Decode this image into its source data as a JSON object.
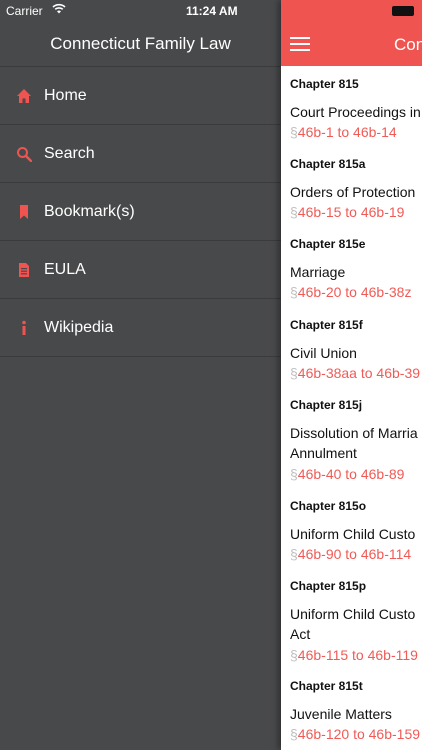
{
  "status": {
    "carrier": "Carrier",
    "time": "11:24 AM"
  },
  "drawer": {
    "title": "Connecticut Family Law",
    "items": [
      {
        "label": "Home",
        "icon": "home-icon"
      },
      {
        "label": "Search",
        "icon": "search-icon"
      },
      {
        "label": "Bookmark(s)",
        "icon": "bookmark-icon"
      },
      {
        "label": "EULA",
        "icon": "document-icon"
      },
      {
        "label": "Wikipedia",
        "icon": "info-icon"
      }
    ]
  },
  "navbar": {
    "title": "Con"
  },
  "chapters": [
    {
      "chapter": "Chapter 815",
      "title": [
        "Court Proceedings in"
      ],
      "symbol": "§",
      "range": "46b-1 to 46b-14"
    },
    {
      "chapter": "Chapter 815a",
      "title": [
        "Orders of Protection"
      ],
      "symbol": "§",
      "range": "46b-15 to 46b-19"
    },
    {
      "chapter": "Chapter 815e",
      "title": [
        "Marriage"
      ],
      "symbol": "§",
      "range": "46b-20 to 46b-38z"
    },
    {
      "chapter": "Chapter 815f",
      "title": [
        "Civil Union"
      ],
      "symbol": "§",
      "range": "46b-38aa to 46b-39"
    },
    {
      "chapter": "Chapter 815j",
      "title": [
        "Dissolution of Marria",
        "Annulment"
      ],
      "symbol": "§",
      "range": "46b-40 to 46b-89"
    },
    {
      "chapter": "Chapter 815o",
      "title": [
        "Uniform Child Custo"
      ],
      "symbol": "§",
      "range": "46b-90 to 46b-114"
    },
    {
      "chapter": "Chapter 815p",
      "title": [
        "Uniform Child Custo",
        "Act"
      ],
      "symbol": "§",
      "range": "46b-115 to 46b-119"
    },
    {
      "chapter": "Chapter 815t",
      "title": [
        "Juvenile Matters"
      ],
      "symbol": "§",
      "range": "46b-120 to 46b-159"
    }
  ],
  "colors": {
    "accent": "#ef5450",
    "drawer_bg": "#48494b",
    "link": "#ef5b57"
  }
}
